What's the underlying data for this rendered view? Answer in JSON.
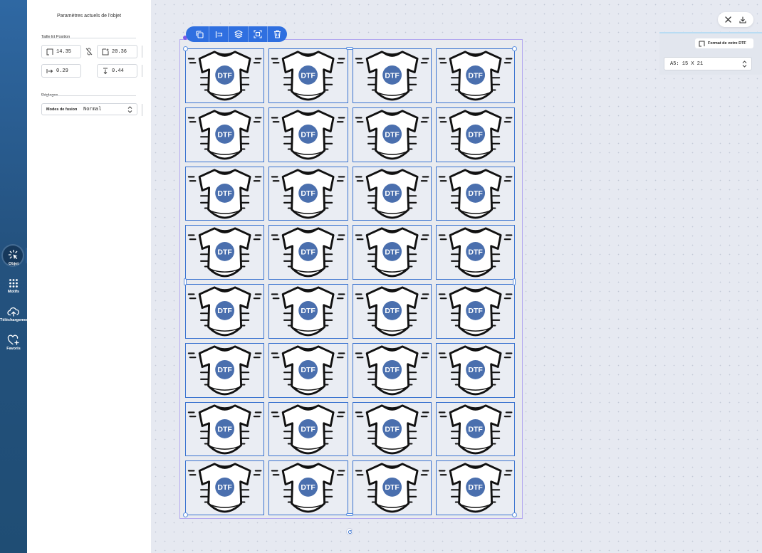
{
  "sidebar": {
    "items": [
      {
        "label": "Objet",
        "icon": "cursor-click-icon",
        "active": true
      },
      {
        "label": "Motifs",
        "icon": "grid-dots-icon"
      },
      {
        "label": "Téléchargements",
        "icon": "cloud-upload-icon"
      },
      {
        "label": "Favoris",
        "icon": "heart-plus-icon"
      }
    ]
  },
  "panel": {
    "title": "Paramètres actuels de l'objet",
    "size_section": "Taille Et Position",
    "width_value": "14.35",
    "height_value": "20.36",
    "x_value": "0.29",
    "y_value": "0.44",
    "settings_section": "Réglages",
    "blend_label": "Modes de fusion",
    "blend_value": "Normal"
  },
  "format": {
    "title": "Format de votre DTF",
    "selected": "A5: 15 X 21"
  },
  "grid": {
    "cols": 4,
    "rows": 8,
    "motif_text": "DTF"
  },
  "colors": {
    "accent": "#2f6fe0",
    "rail": "#24527f",
    "motif_blue": "#4a6fae"
  }
}
